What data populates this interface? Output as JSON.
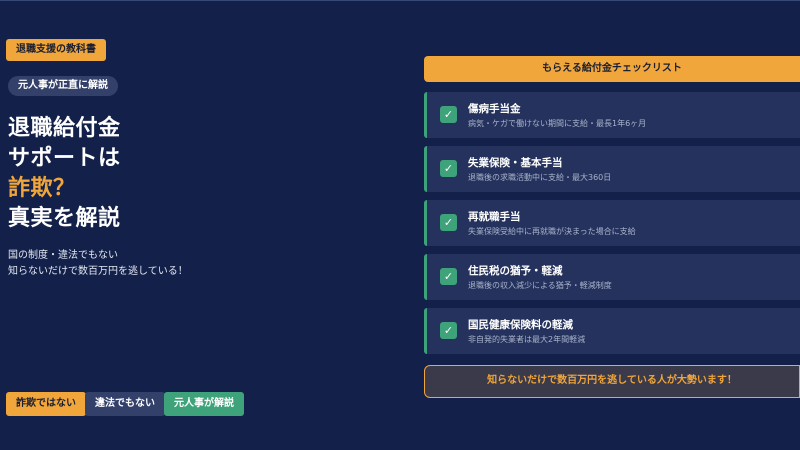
{
  "brand_pill": "退職支援の教科書",
  "sub_pill": "元人事が正直に解説",
  "headline": {
    "line1": "退職給付金",
    "line2": "サポートは",
    "line3": "詐欺？",
    "line4": "真実を解説"
  },
  "description": {
    "line1": "国の制度・違法でもない",
    "line2": "知らないだけで数百万円を逃している！"
  },
  "tags": [
    "詐欺ではない",
    "違法でもない",
    "元人事が解説"
  ],
  "checklist": {
    "header": "もらえる給付金チェックリスト",
    "items": [
      {
        "title": "傷病手当金",
        "subtitle": "病気・ケガで働けない期間に支給・最長1年6ヶ月"
      },
      {
        "title": "失業保険・基本手当",
        "subtitle": "退職後の求職活動中に支給・最大360日"
      },
      {
        "title": "再就職手当",
        "subtitle": "失業保険受給中に再就職が決まった場合に支給"
      },
      {
        "title": "住民税の猶予・軽減",
        "subtitle": "退職後の収入減少による猶予・軽減制度"
      },
      {
        "title": "国民健康保険料の軽減",
        "subtitle": "非自発的失業者は最大2年間軽減"
      }
    ],
    "check_icon": "check-icon",
    "check_glyph": "✓",
    "footer": "知らないだけで数百万円を逃している人が大勢います！"
  },
  "colors": {
    "background": "#13214a",
    "accent": "#f0a63a",
    "green": "#3ea27a",
    "card": "#24325d"
  }
}
